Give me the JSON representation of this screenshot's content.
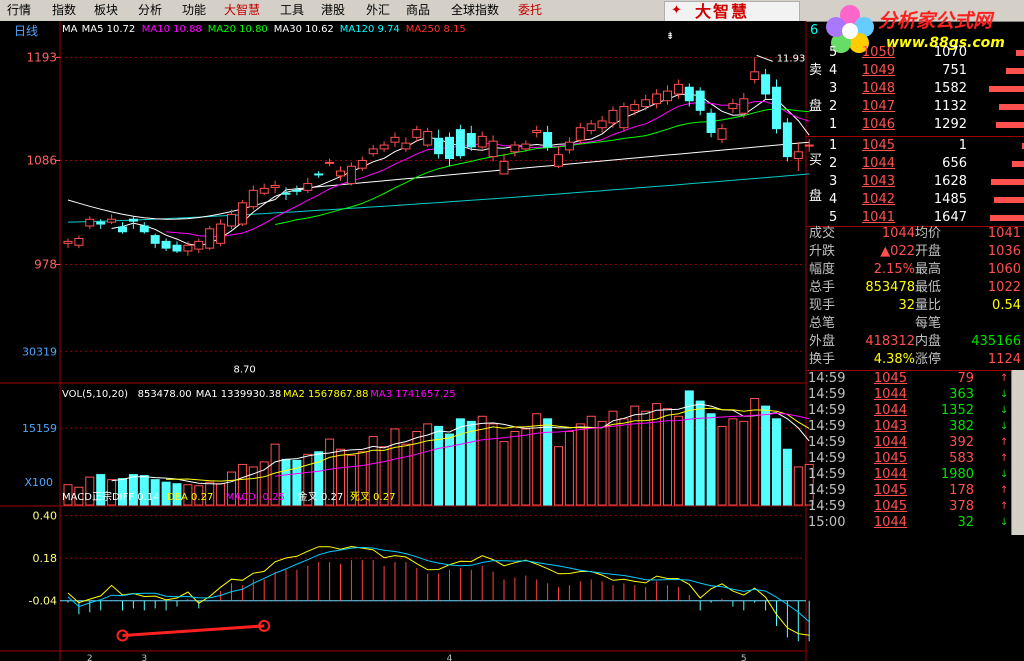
{
  "menu": {
    "items": [
      "行情",
      "指数",
      "板块",
      "分析",
      "功能",
      "大智慧",
      "工具",
      "港股",
      "外汇",
      "商品",
      "全球指数",
      "委托"
    ],
    "brand_logo": "大智慧"
  },
  "site_logo": {
    "title": "分析家公式网",
    "url_text": "www.88gs.com"
  },
  "chart": {
    "period": "日线",
    "ma_legend": [
      {
        "text": "MA",
        "color": "#ffffff"
      },
      {
        "text": "MA5 10.72",
        "color": "#ffffff"
      },
      {
        "text": "MA10 10.88",
        "color": "#ff00ff"
      },
      {
        "text": "MA20 10.80",
        "color": "#00ff00"
      },
      {
        "text": "MA30 10.62",
        "color": "#ffffff"
      },
      {
        "text": "MA120 9.74",
        "color": "#00ffff"
      },
      {
        "text": "MA250 8.15",
        "color": "#ff3030"
      }
    ],
    "price_axis": [
      "1193",
      "1086",
      "978"
    ],
    "high_marker": "11.93",
    "low_marker": "8.70",
    "vol_legend": [
      {
        "text": "VOL(5,10,20)",
        "color": "#ffffff"
      },
      {
        "text": "853478.00",
        "color": "#ffffff"
      },
      {
        "text": "MA1 1339930.38",
        "color": "#ffffff"
      },
      {
        "text": "MA2 1567867.88",
        "color": "#ffff00"
      },
      {
        "text": "MA3 1741657.25",
        "color": "#ff00ff"
      }
    ],
    "vol_axis": [
      "30319",
      "15159",
      "X100"
    ],
    "macd_legend": [
      {
        "text": "MACD正宗DIFF 0.14",
        "color": "#ffffff"
      },
      {
        "text": "DEA 0.27",
        "color": "#ffff00"
      },
      {
        "text": "MACD -0.25",
        "color": "#ff00ff"
      },
      {
        "text": "金叉 0.27",
        "color": "#ffffff"
      },
      {
        "text": "死叉 0.27",
        "color": "#ffff00"
      }
    ],
    "macd_axis": [
      "0.40",
      "0.18",
      "-0.04"
    ],
    "date_ticks": [
      "2",
      "3",
      "4",
      "5"
    ],
    "series": {
      "open": [
        10.0,
        9.98,
        10.18,
        10.22,
        10.22,
        10.17,
        10.25,
        10.18,
        10.08,
        10.02,
        9.98,
        9.92,
        9.94,
        9.95,
        10.0,
        10.18,
        10.2,
        10.38,
        10.52,
        10.58,
        10.52,
        10.55,
        10.55,
        10.72,
        10.84,
        10.7,
        10.62,
        10.78,
        10.93,
        10.98,
        11.05,
        10.98,
        11.1,
        11.02,
        11.09,
        11.1,
        11.18,
        11.14,
        11.0,
        10.9,
        10.72,
        10.95,
        10.98,
        11.15,
        11.15,
        10.8,
        10.97,
        11.07,
        11.17,
        11.2,
        11.25,
        11.2,
        11.38,
        11.42,
        11.45,
        11.48,
        11.55,
        11.62,
        11.58,
        11.35,
        11.08,
        11.4,
        11.35,
        11.7,
        11.75,
        11.62,
        11.25,
        10.88,
        11.02
      ],
      "close": [
        10.02,
        10.05,
        10.25,
        10.2,
        10.25,
        10.12,
        10.23,
        10.12,
        10.0,
        9.95,
        9.92,
        9.98,
        10.02,
        10.15,
        10.2,
        10.3,
        10.42,
        10.55,
        10.57,
        10.6,
        10.51,
        10.54,
        10.62,
        10.71,
        10.84,
        10.75,
        10.8,
        10.86,
        10.98,
        11.02,
        11.1,
        11.04,
        11.18,
        11.16,
        10.93,
        10.88,
        10.91,
        11.0,
        11.11,
        11.06,
        10.85,
        11.02,
        11.03,
        11.17,
        11.0,
        10.92,
        11.05,
        11.2,
        11.24,
        11.27,
        11.38,
        11.42,
        11.44,
        11.49,
        11.55,
        11.58,
        11.65,
        11.48,
        11.38,
        11.15,
        11.19,
        11.45,
        11.5,
        11.78,
        11.55,
        11.19,
        10.9,
        10.95,
        11.02
      ],
      "high": [
        10.05,
        10.08,
        10.28,
        10.25,
        10.3,
        10.22,
        10.28,
        10.22,
        10.1,
        10.05,
        10.02,
        10.02,
        10.05,
        10.18,
        10.25,
        10.35,
        10.45,
        10.6,
        10.62,
        10.65,
        10.58,
        10.6,
        10.68,
        10.75,
        10.88,
        10.8,
        10.84,
        10.9,
        11.02,
        11.06,
        11.15,
        11.1,
        11.22,
        11.2,
        11.18,
        11.15,
        11.23,
        11.22,
        11.16,
        11.12,
        10.93,
        11.06,
        11.07,
        11.22,
        11.22,
        11.0,
        11.1,
        11.25,
        11.28,
        11.32,
        11.42,
        11.46,
        11.49,
        11.54,
        11.6,
        11.64,
        11.7,
        11.66,
        11.62,
        11.4,
        11.24,
        11.5,
        11.56,
        11.93,
        11.81,
        11.7,
        11.3,
        11.05,
        11.08
      ],
      "low": [
        9.95,
        9.95,
        10.15,
        10.15,
        10.2,
        10.1,
        10.15,
        10.1,
        9.95,
        9.92,
        9.9,
        9.87,
        9.9,
        9.93,
        9.97,
        10.15,
        10.18,
        10.35,
        10.5,
        10.52,
        10.45,
        10.5,
        10.52,
        10.68,
        10.8,
        10.65,
        10.6,
        10.75,
        10.9,
        10.95,
        11.0,
        10.95,
        11.05,
        11.0,
        10.88,
        10.8,
        10.88,
        10.96,
        10.98,
        10.85,
        10.72,
        10.9,
        10.95,
        11.1,
        10.96,
        10.78,
        10.93,
        11.03,
        11.13,
        11.15,
        11.2,
        11.16,
        11.33,
        11.38,
        11.4,
        11.44,
        11.5,
        11.42,
        11.33,
        11.1,
        11.04,
        11.35,
        11.3,
        11.66,
        11.5,
        11.14,
        10.85,
        10.75,
        10.95
      ],
      "volume": [
        4000,
        3500,
        5500,
        6000,
        5000,
        5200,
        6000,
        5800,
        5000,
        4500,
        4200,
        4000,
        3800,
        4500,
        4200,
        6500,
        8000,
        7500,
        8500,
        12000,
        9000,
        8800,
        10000,
        10500,
        13000,
        11000,
        9800,
        10500,
        13500,
        11500,
        15000,
        12000,
        14500,
        16000,
        15500,
        14000,
        17000,
        16500,
        17500,
        16000,
        12500,
        14500,
        15000,
        18000,
        17000,
        11500,
        14500,
        16000,
        17500,
        16500,
        18500,
        17000,
        19500,
        18500,
        20000,
        19000,
        17500,
        22500,
        20500,
        18000,
        15500,
        17000,
        16500,
        21000,
        19500,
        17000,
        11000,
        7500,
        8000
      ],
      "macd": [
        -0.05,
        -0.11,
        -0.1,
        -0.09,
        -0.04,
        -0.09,
        -0.08,
        -0.09,
        -0.08,
        -0.09,
        -0.07,
        -0.03,
        -0.08,
        -0.04,
        0.01,
        0.05,
        0.04,
        0.07,
        0.07,
        0.11,
        0.12,
        0.12,
        0.14,
        0.16,
        0.16,
        0.15,
        0.17,
        0.17,
        0.17,
        0.14,
        0.16,
        0.16,
        0.13,
        0.1,
        0.1,
        0.12,
        0.13,
        0.12,
        0.14,
        0.11,
        0.07,
        0.08,
        0.09,
        0.07,
        0.05,
        0.03,
        0.04,
        0.06,
        0.07,
        0.06,
        0.04,
        0.05,
        0.04,
        0.03,
        0.06,
        0.04,
        0.03,
        -0.01,
        -0.09,
        -0.05,
        -0.03,
        -0.07,
        -0.09,
        -0.05,
        -0.09,
        -0.17,
        -0.23,
        -0.25,
        -0.25
      ]
    }
  },
  "order_book": {
    "code_partial": "6",
    "sell_label": [
      "卖",
      "盘"
    ],
    "buy_label": [
      "买",
      "盘"
    ],
    "sell": [
      {
        "level": "5",
        "price": "1050",
        "vol": "1070"
      },
      {
        "level": "4",
        "price": "1049",
        "vol": "751"
      },
      {
        "level": "3",
        "price": "1048",
        "vol": "1582"
      },
      {
        "level": "2",
        "price": "1047",
        "vol": "1132"
      },
      {
        "level": "1",
        "price": "1046",
        "vol": "1292"
      }
    ],
    "buy": [
      {
        "level": "1",
        "price": "1045",
        "vol": "1"
      },
      {
        "level": "2",
        "price": "1044",
        "vol": "656"
      },
      {
        "level": "3",
        "price": "1043",
        "vol": "1628"
      },
      {
        "level": "4",
        "price": "1042",
        "vol": "1485"
      },
      {
        "level": "5",
        "price": "1041",
        "vol": "1647"
      }
    ]
  },
  "stats": [
    {
      "l1": "成交",
      "v1": "1044",
      "l2": "均价",
      "v2": "1041",
      "c1": "r",
      "c2": "r"
    },
    {
      "l1": "升跌",
      "v1": "▲022",
      "l2": "开盘",
      "v2": "1036",
      "c1": "r",
      "c2": "r"
    },
    {
      "l1": "幅度",
      "v1": "2.15%",
      "l2": "最高",
      "v2": "1060",
      "c1": "r",
      "c2": "r"
    },
    {
      "l1": "总手",
      "v1": "853478",
      "l2": "最低",
      "v2": "1022",
      "c1": "y",
      "c2": "r"
    },
    {
      "l1": "现手",
      "v1": "32",
      "l2": "量比",
      "v2": "0.54",
      "c1": "y",
      "c2": "y"
    },
    {
      "l1": "总笔",
      "v1": "",
      "l2": "每笔",
      "v2": "",
      "c1": "s",
      "c2": "s"
    },
    {
      "l1": "外盘",
      "v1": "418312",
      "l2": "内盘",
      "v2": "435166",
      "c1": "r",
      "c2": "g"
    },
    {
      "l1": "换手",
      "v1": "4.38%",
      "l2": "涨停",
      "v2": "1124",
      "c1": "y",
      "c2": "r"
    }
  ],
  "ticks": [
    {
      "time": "14:59",
      "price": "1045",
      "vol": "79",
      "vc": "r"
    },
    {
      "time": "14:59",
      "price": "1044",
      "vol": "363",
      "vc": "g"
    },
    {
      "time": "14:59",
      "price": "1044",
      "vol": "1352",
      "vc": "g"
    },
    {
      "time": "14:59",
      "price": "1043",
      "vol": "382",
      "vc": "g"
    },
    {
      "time": "14:59",
      "price": "1044",
      "vol": "392",
      "vc": "r"
    },
    {
      "time": "14:59",
      "price": "1045",
      "vol": "583",
      "vc": "r"
    },
    {
      "time": "14:59",
      "price": "1044",
      "vol": "1980",
      "vc": "g"
    },
    {
      "time": "14:59",
      "price": "1045",
      "vol": "178",
      "vc": "r"
    },
    {
      "time": "14:59",
      "price": "1045",
      "vol": "378",
      "vc": "r"
    },
    {
      "time": "15:00",
      "price": "1044",
      "vol": "32",
      "vc": "g"
    }
  ],
  "colors": {
    "up": "#ff5050",
    "down": "#54ffff",
    "grid": "#a00000",
    "bg": "#000000"
  }
}
